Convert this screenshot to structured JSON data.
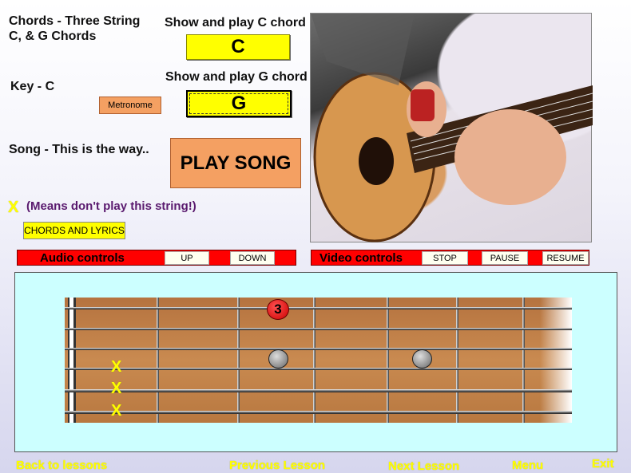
{
  "lesson_title": "Chords - Three String C, & G Chords",
  "key_label": "Key - C",
  "song_label": "Song - This is the way..",
  "metronome_label": "Metronome",
  "chord_c": {
    "caption": "Show and play C chord",
    "label": "C"
  },
  "chord_g": {
    "caption": "Show and play G chord",
    "label": "G"
  },
  "play_song_label": "PLAY SONG",
  "x_legend": {
    "symbol": "X",
    "text": "(Means don't play this string!)"
  },
  "chords_lyrics_label": "CHORDS AND LYRICS",
  "audio_controls": {
    "title": "Audio controls",
    "up": "UP",
    "down": "DOWN"
  },
  "video_controls": {
    "title": "Video controls",
    "stop": "STOP",
    "pause": "PAUSE",
    "resume": "RESUME"
  },
  "fretboard": {
    "finger_number": "3",
    "muted_symbol": "X",
    "muted_strings": 3
  },
  "nav": {
    "back": "Back to lessons",
    "previous": "Previous Lesson",
    "next": "Next Lesson",
    "menu": "Menu",
    "exit": "Exit"
  },
  "colors": {
    "accent_yellow": "#ffff00",
    "control_red": "#ff0000",
    "panel_cyan": "#ccffff",
    "button_orange": "#f4a062"
  }
}
